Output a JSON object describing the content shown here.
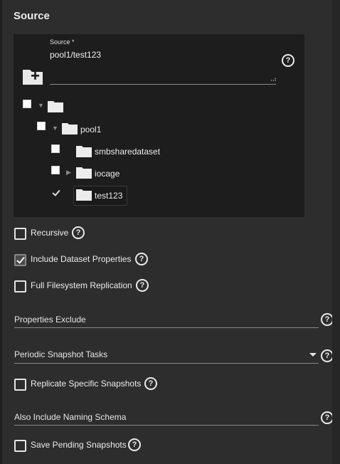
{
  "section": {
    "title": "Source"
  },
  "source": {
    "label": "Source *",
    "value": "pool1/test123",
    "help": "?",
    "grip": "⠠⠴"
  },
  "tree": {
    "nodes": [
      {
        "label": "",
        "checked": false,
        "expander": "▼"
      },
      {
        "label": "pool1",
        "checked": false,
        "expander": "▼"
      },
      {
        "label": "smbsharedataset",
        "checked": false,
        "expander": ""
      },
      {
        "label": "iocage",
        "checked": false,
        "expander": "▶"
      },
      {
        "label": "test123",
        "checked": true,
        "expander": ""
      }
    ]
  },
  "options": {
    "recursive": {
      "label": "Recursive",
      "checked": false,
      "help": "?"
    },
    "include_props": {
      "label": "Include Dataset Properties",
      "checked": true,
      "help": "?"
    },
    "full_fs": {
      "label": "Full Filesystem Replication",
      "checked": false,
      "help": "?"
    },
    "replicate_specific": {
      "label": "Replicate Specific Snapshots",
      "checked": false,
      "help": "?"
    },
    "save_pending": {
      "label": "Save Pending Snapshots",
      "checked": false,
      "help": "?"
    }
  },
  "fields": {
    "properties_exclude": {
      "label": "Properties Exclude",
      "help": "?"
    },
    "periodic_tasks": {
      "label": "Periodic Snapshot Tasks",
      "help": "?"
    },
    "naming_schema": {
      "label": "Also Include Naming Schema",
      "help": "?"
    }
  },
  "colors": {
    "background": "#282828",
    "panel": "#2d2d2d",
    "source_box": "#1d1d1d",
    "text": "#ececec"
  }
}
